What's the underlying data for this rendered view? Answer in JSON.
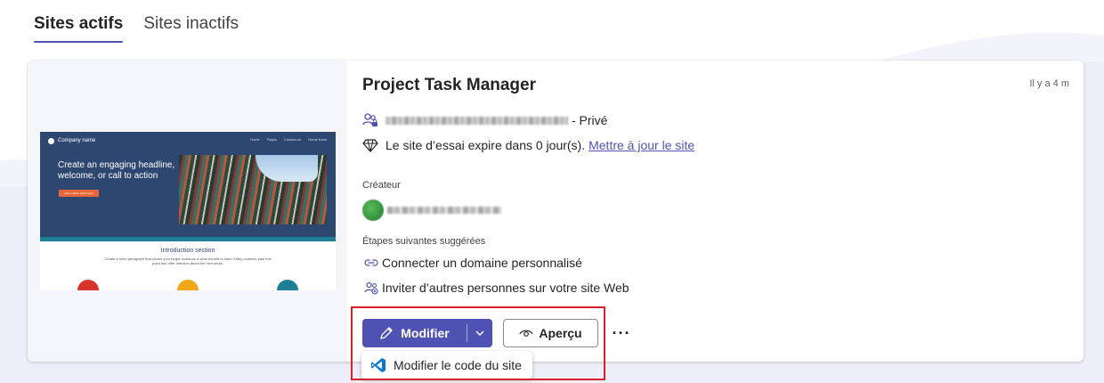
{
  "tabs": [
    {
      "label": "Sites actifs",
      "active": true
    },
    {
      "label": "Sites inactifs",
      "active": false
    }
  ],
  "site": {
    "title": "Project Task Manager",
    "time": "Il y a 4 m",
    "visibility": "- Privé",
    "trial_text": "Le site d’essai expire dans 0 jour(s).",
    "trial_link": "Mettre à jour le site",
    "creator_label": "Créateur",
    "next_steps_label": "Étapes suivantes suggérées",
    "steps": [
      {
        "label": "Connecter un domaine personnalisé",
        "icon": "link-icon"
      },
      {
        "label": "Inviter d’autres personnes sur votre site Web",
        "icon": "people-add-icon"
      }
    ]
  },
  "preview": {
    "company": "Company name",
    "menu": [
      "Home",
      "Pages",
      "Contact us",
      "Home Kami"
    ],
    "headline": "Create an engaging headline, welcome, or call to action",
    "cta": "Add a call to action here",
    "intro_title": "Introduction section",
    "intro_text": "Create a short paragraph that shows your target audience a clear benefit to them if they continue past this point and offer direction about the next steps."
  },
  "actions": {
    "edit_label": "Modifier",
    "preview_label": "Aperçu",
    "more_label": "···",
    "dropdown_item": "Modifier le code du site"
  },
  "colors": {
    "accent": "#4f52b2",
    "highlight": "#d9202a"
  }
}
